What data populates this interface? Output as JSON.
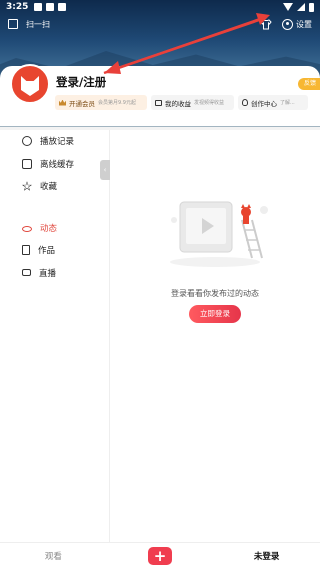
{
  "status_bar": {
    "time": "3:25"
  },
  "topbar": {
    "scan_label": "扫一扫",
    "settings_label": "设置"
  },
  "profile": {
    "title": "登录/注册",
    "feedback": "反馈",
    "vip": {
      "label": "开通会员",
      "sub": "会员第月9.9元起"
    },
    "income": {
      "label": "我的收益",
      "sub": "发视频得收益"
    },
    "creator": {
      "label": "创作中心",
      "sub": "了解..."
    }
  },
  "sidebar": {
    "items": [
      {
        "label": "播放记录",
        "icon": "history-icon"
      },
      {
        "label": "离线缓存",
        "icon": "download-icon"
      },
      {
        "label": "收藏",
        "icon": "star-icon"
      },
      {
        "label": "动态",
        "icon": "dynamic-icon",
        "active": true
      },
      {
        "label": "作品",
        "icon": "works-icon"
      },
      {
        "label": "直播",
        "icon": "live-icon"
      }
    ],
    "collapse": "‹"
  },
  "empty_state": {
    "text": "登录看看你发布过的动态",
    "button": "立即登录"
  },
  "bottom_nav": {
    "watch": "观看",
    "plus": "+",
    "me": "未登录"
  },
  "colors": {
    "accent": "#e0443a",
    "vip_bg": "#fdf0e3",
    "feedback": "#f7b733"
  }
}
